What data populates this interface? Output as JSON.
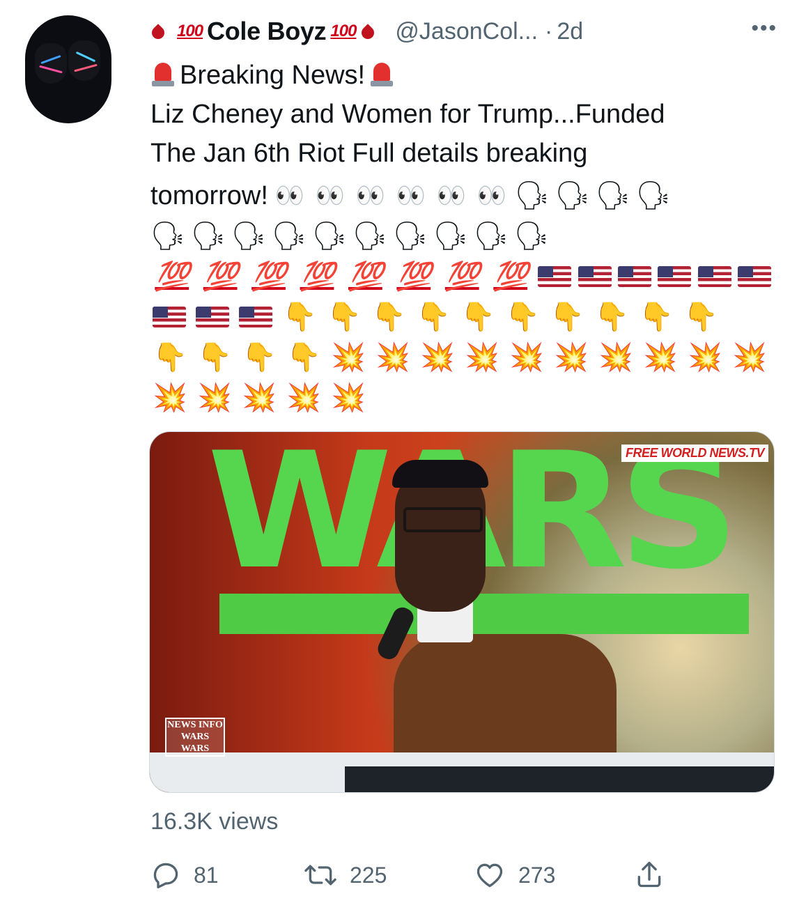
{
  "author": {
    "name": "Cole Boyz",
    "hundred_emoji": "100",
    "handle": "@JasonCol...",
    "dot": "·",
    "time": "2d",
    "more": "•••"
  },
  "tweet": {
    "line1": "Breaking News!",
    "line2": "Liz Cheney and Women for Trump...Funded",
    "line3": "The Jan 6th Riot Full details breaking",
    "line4": "tomorrow!"
  },
  "emoji": {
    "eyes": "👀",
    "speaking_head": "🗣",
    "hundred": "💯",
    "flag": "us-flag",
    "point_down": "👇",
    "collision": "💥"
  },
  "media": {
    "badge": "FREE WORLD NEWS.TV",
    "backdrop_text": "WARS",
    "logo_line1": "NEWS INFO",
    "logo_line2": "WARS WARS"
  },
  "stats": {
    "views": "16.3K views",
    "replies": "81",
    "retweets": "225",
    "likes": "273"
  },
  "colors": {
    "text": "#0f1419",
    "muted": "#536471",
    "accent_red": "#d0021b"
  }
}
